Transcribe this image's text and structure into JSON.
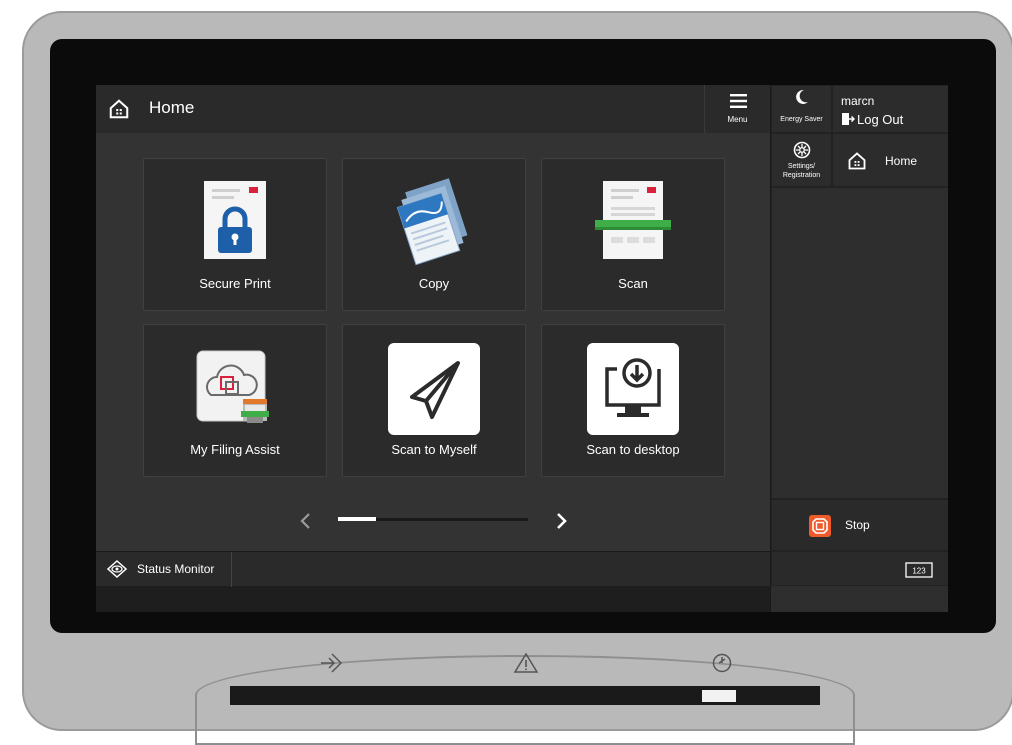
{
  "header": {
    "title": "Home",
    "menu_label": "Menu"
  },
  "tiles": [
    {
      "label": "Secure Print"
    },
    {
      "label": "Copy"
    },
    {
      "label": "Scan"
    },
    {
      "label": "My Filing Assist"
    },
    {
      "label": "Scan to Myself"
    },
    {
      "label": "Scan to desktop"
    }
  ],
  "pager": {
    "current_page": 1
  },
  "status_bar": {
    "status_monitor_label": "Status Monitor"
  },
  "right_panel": {
    "energy_saver_label": "Energy Saver",
    "username": "marcn",
    "logout_label": "Log Out",
    "settings_label_line1": "Settings/",
    "settings_label_line2": "Registration",
    "home_label": "Home",
    "stop_label": "Stop",
    "keyboard_label": "123"
  },
  "colors": {
    "stop_orange": "#ef5a2a",
    "screen_bg": "#333333",
    "accent_green": "#3fae49"
  }
}
